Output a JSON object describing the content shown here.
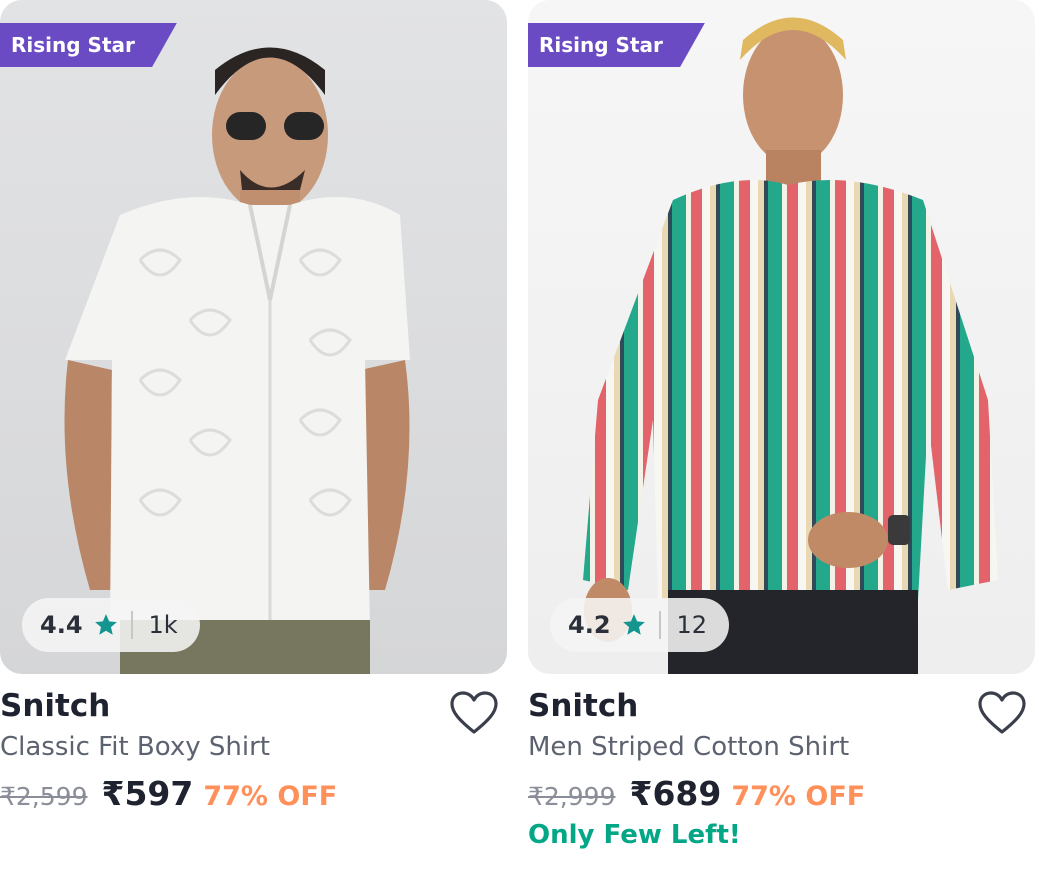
{
  "colors": {
    "badge": "#6a4bc4",
    "star": "#14958f",
    "discount": "#ff905a",
    "stock_alert": "#03a685",
    "text_primary": "#1f2330",
    "text_secondary": "#5d6270"
  },
  "products": [
    {
      "badge": "Rising Star",
      "rating": "4.4",
      "rating_count": "1k",
      "brand": "Snitch",
      "title": "Classic Fit Boxy Shirt",
      "mrp": "₹2,599",
      "price": "₹597",
      "discount": "77% OFF",
      "stock_note": "",
      "image_alt": "man in white textured short-sleeve shirt"
    },
    {
      "badge": "Rising Star",
      "rating": "4.2",
      "rating_count": "12",
      "brand": "Snitch",
      "title": "Men Striped Cotton Shirt",
      "mrp": "₹2,999",
      "price": "₹689",
      "discount": "77% OFF",
      "stock_note": "Only Few Left!",
      "image_alt": "man in multicolour striped long-sleeve shirt"
    }
  ]
}
